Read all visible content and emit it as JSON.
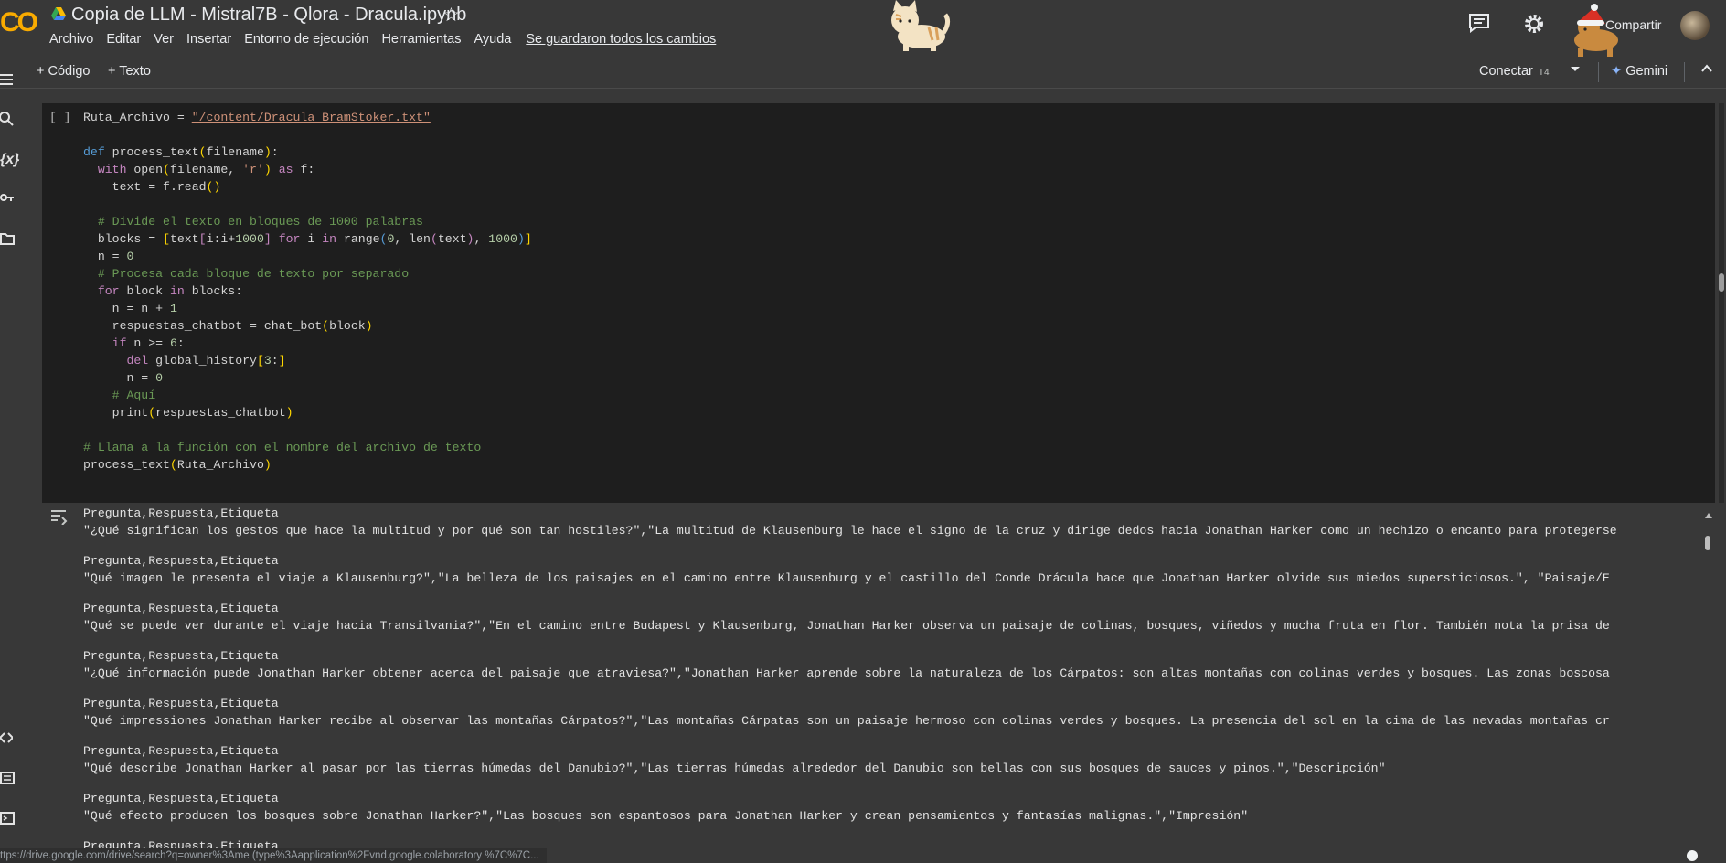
{
  "app": {
    "logo_text": "CO",
    "title": "Copia de LLM - Mistral7B - Qlora - Dracula.ipynb"
  },
  "menu": {
    "items": [
      "Archivo",
      "Editar",
      "Ver",
      "Insertar",
      "Entorno de ejecución",
      "Herramientas",
      "Ayuda"
    ],
    "saved_status": "Se guardaron todos los cambios"
  },
  "header": {
    "share_label": "Compartir"
  },
  "toolbar": {
    "add_code_label": "+ Código",
    "add_text_label": "+ Texto",
    "connect_label": "Conectar",
    "runtime_label": "T4",
    "gemini_label": "Gemini"
  },
  "cell": {
    "run_status": "[ ]"
  },
  "output_header": "Pregunta,Respuesta,Etiqueta",
  "output_rows": [
    "\"¿Qué significan los gestos que hace la multitud y por qué son tan hostiles?\",\"La multitud de Klausenburg le hace el signo de la cruz y dirige dedos hacia Jonathan Harker como un hechizo o encanto para protegerse",
    "\"Qué imagen le presenta el viaje a Klausenburg?\",\"La belleza de los paisajes en el camino entre Klausenburg y el castillo del Conde Drácula hace que Jonathan Harker olvide sus miedos supersticiosos.\", \"Paisaje/E",
    "\"Qué se puede ver durante el viaje hacia Transilvania?\",\"En el camino entre Budapest y Klausenburg, Jonathan Harker observa un paisaje de colinas, bosques, viñedos y mucha fruta en flor. También nota la prisa de",
    "\"¿Qué información puede Jonathan Harker obtener acerca del paisaje que atraviesa?\",\"Jonathan Harker aprende sobre la naturaleza de los Cárpatos: son altas montañas con colinas verdes y bosques. Las zonas boscosa",
    "\"Qué impressiones Jonathan Harker recibe al observar las montañas Cárpatos?\",\"Las montañas Cárpatas son un paisaje hermoso con colinas verdes y bosques. La presencia del sol en la cima de las nevadas montañas cr",
    "\"Qué describe Jonathan Harker al pasar por las tierras húmedas del Danubio?\",\"Las tierras húmedas alrededor del Danubio son bellas con sus bosques de sauces y pinos.\",\"Descripción\"",
    "\"Qué efecto producen los bosques sobre Jonathan Harker?\",\"Las bosques son espantosos para Jonathan Harker y crean pensamientos y fantasías malignas.\",\"Impresión\""
  ],
  "status_url": "ttps://drive.google.com/drive/search?q=owner%3Ame (type%3Aapplication%2Fvnd.google.colaboratory %7C%7C..."
}
